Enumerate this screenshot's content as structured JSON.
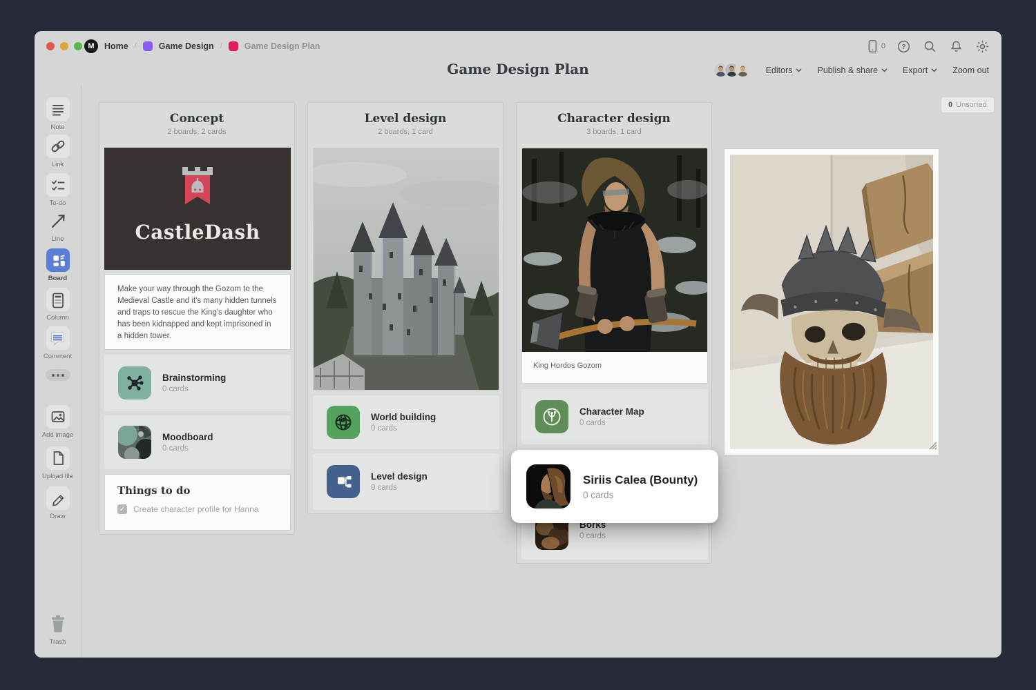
{
  "topbar": {
    "breadcrumb": [
      {
        "label": "Home"
      },
      {
        "label": "Game Design"
      },
      {
        "label": "Game Design Plan"
      }
    ],
    "mobile_count": "0",
    "right_icons": [
      "mobile-icon",
      "help-icon",
      "search-icon",
      "notifications-icon",
      "settings-icon"
    ]
  },
  "header": {
    "title": "Game Design Plan",
    "editors": "Editors",
    "publish": "Publish & share",
    "export": "Export",
    "zoom_out": "Zoom out"
  },
  "toolbar": {
    "note": "Note",
    "link": "Link",
    "todo": "To-do",
    "line": "Line",
    "board": "Board",
    "column": "Column",
    "comment": "Comment",
    "add_image": "Add image",
    "upload_file": "Upload file",
    "draw": "Draw",
    "trash": "Trash"
  },
  "canvas": {
    "unsorted": {
      "count": "0",
      "label": "Unsorted"
    },
    "columns": [
      {
        "title": "Concept",
        "subtitle": "2 boards, 2 cards",
        "logo_card": {
          "title": "CastleDash"
        },
        "note": "Make your way through the Gozom to the Medieval Castle and it's many hidden tunnels and traps to rescue the King's daughter who has been kidnapped and kept imprisoned in a hidden tower.",
        "boards": [
          {
            "name": "Brainstorming",
            "count": "0 cards"
          },
          {
            "name": "Moodboard",
            "count": "0 cards"
          }
        ],
        "todo": {
          "title": "Things to do",
          "items": [
            {
              "label": "Create character profile for Hanna",
              "checked": true
            }
          ]
        }
      },
      {
        "title": "Level design",
        "subtitle": "2 boards, 1 card",
        "boards": [
          {
            "name": "World building",
            "count": "0 cards"
          },
          {
            "name": "Level design",
            "count": "0 cards"
          }
        ]
      },
      {
        "title": "Character design",
        "subtitle": "3 boards, 1 card",
        "image_caption": "King Hordos Gozom",
        "boards": [
          {
            "name": "Character Map",
            "count": "0 cards"
          },
          {
            "name": "Borks",
            "count": "0 cards"
          }
        ]
      }
    ],
    "drag_card": {
      "name": "Siriis Calea (Bounty)",
      "count": "0 cards"
    }
  },
  "colors": {
    "board_tool_blue": "#5a7ed5",
    "brainstorm_teal": "#7fb0a0",
    "world_green": "#55a160",
    "level_blue": "#44618e",
    "charmap_green": "#5f8f57",
    "banner_red": "#d64457",
    "breadcrumb_purple": "#8b5cf6",
    "breadcrumb_red": "#e11d5b",
    "window_bg": "#d5d7d6",
    "desktop_bg": "#272b39"
  }
}
